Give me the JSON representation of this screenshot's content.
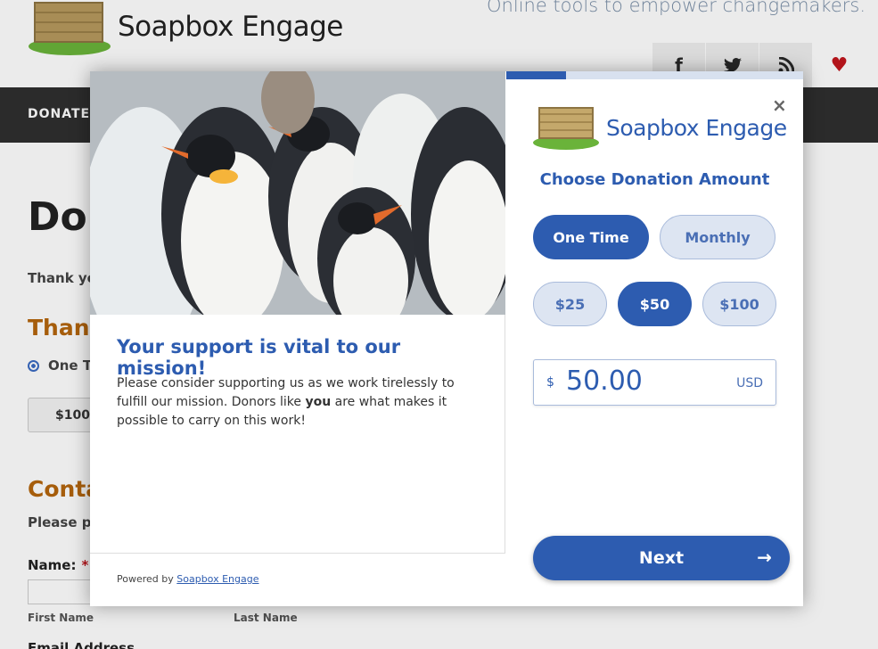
{
  "site": {
    "logo_text": "Soapbox Engage",
    "tagline": "Online tools to empower changemakers.",
    "social": {
      "facebook": "f",
      "twitter": "t",
      "rss": "rss",
      "heart": "♥"
    },
    "nav_donate": "DONATE"
  },
  "page": {
    "title": "Don",
    "thank_text": "Thank yo",
    "section_heading": "Thank",
    "frequency_radio": "One T",
    "amount_button": "$100",
    "contact_heading": "Conta",
    "please_text": "Please pr",
    "name_label": "Name:",
    "required_mark": "*",
    "first_name_label": "First Name",
    "last_name_label": "Last Name",
    "email_label": "Email Address"
  },
  "modal": {
    "support_heading": "Your support is vital to our mission!",
    "support_text_1": "Please consider supporting us as we work tirelessly to fulfill our mission. Donors like ",
    "support_text_bold": "you",
    "support_text_2": " are what makes it possible to carry on this work!",
    "powered_by": "Powered by",
    "powered_link": "Soapbox Engage",
    "progress": 0.2,
    "close_label": "×",
    "logo_text": "Soapbox Engage",
    "choose_heading": "Choose Donation Amount",
    "frequency": {
      "one_time": "One Time",
      "monthly": "Monthly",
      "selected": "One Time"
    },
    "amounts": [
      "$25",
      "$50",
      "$100"
    ],
    "selected_amount": "$50",
    "amount_input": {
      "currency_symbol": "$",
      "value": "50.00",
      "currency_code": "USD"
    },
    "next_label": "Next",
    "next_arrow": "→"
  },
  "colors": {
    "brand_blue": "#2d5cb0",
    "light_blue": "#dde5f2",
    "accent_orange": "#b5650d",
    "heart_red": "#c2161d",
    "nav_dark": "#2f2f2f"
  }
}
